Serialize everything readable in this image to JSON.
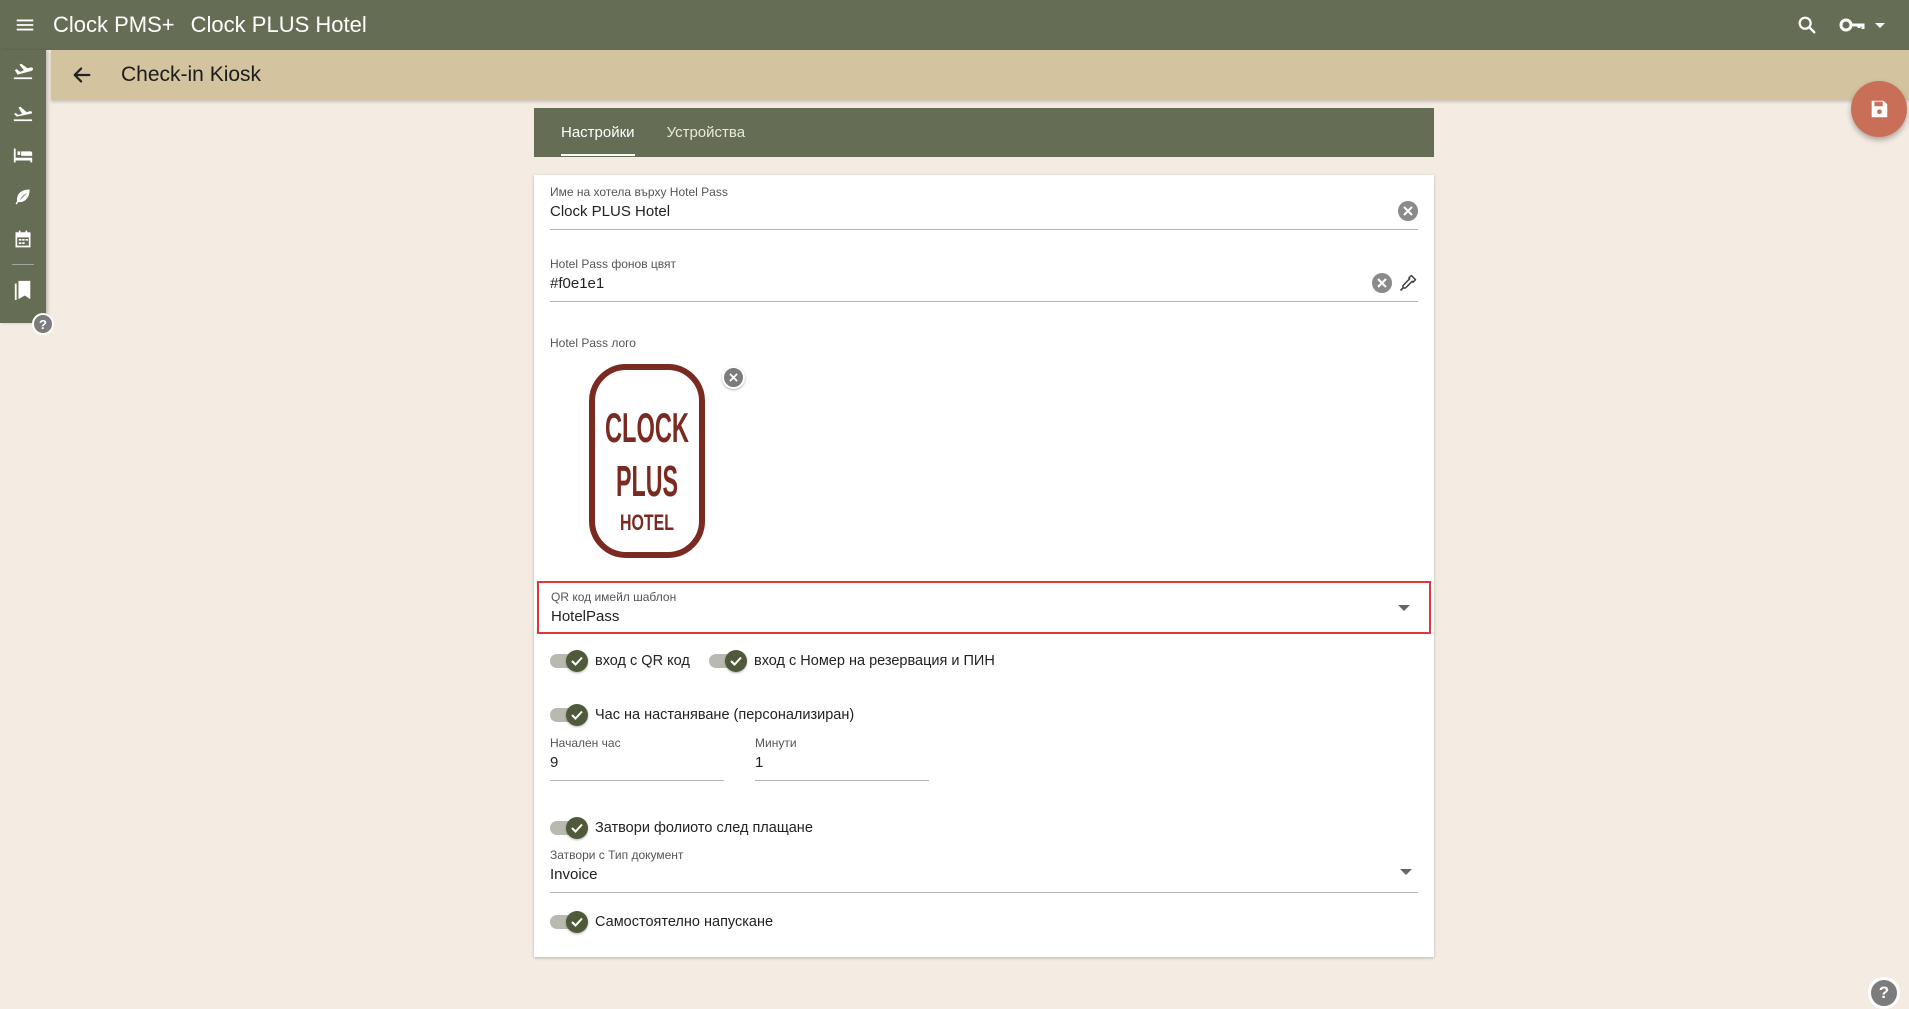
{
  "topbar": {
    "app_name": "Clock PMS+",
    "hotel_name": "Clock PLUS Hotel"
  },
  "subbar": {
    "title": "Check-in Kiosk"
  },
  "tabs": [
    {
      "label": "Настройки",
      "active": true
    },
    {
      "label": "Устройства",
      "active": false
    }
  ],
  "form": {
    "hotel_name": {
      "label": "Име на хотела върху Hotel Pass",
      "value": "Clock PLUS Hotel"
    },
    "bg_color": {
      "label": "Hotel Pass фонов цвят",
      "value": "#f0e1e1"
    },
    "logo": {
      "label": "Hotel Pass лого",
      "line1": "CLOCK",
      "line2": "PLUS",
      "line3": "HOTEL"
    },
    "qr_template": {
      "label": "QR код имейл шаблон",
      "value": "HotelPass"
    },
    "toggle_qr": {
      "label": "вход с QR код",
      "on": true
    },
    "toggle_pin": {
      "label": "вход с Номер на резервация и ПИН",
      "on": true
    },
    "toggle_checkin_time": {
      "label": "Час на настаняване (персонализиран)",
      "on": true
    },
    "start_hour": {
      "label": "Начален час",
      "value": "9"
    },
    "minutes": {
      "label": "Минути",
      "value": "1"
    },
    "toggle_close_folio": {
      "label": "Затвори фолиото след плащане",
      "on": true
    },
    "doc_type": {
      "label": "Затвори с Тип документ",
      "value": "Invoice"
    },
    "toggle_self_checkout": {
      "label": "Самостоятелно напускане",
      "on": true
    }
  },
  "help": {
    "symbol": "?"
  },
  "colors": {
    "primary": "#656e55",
    "subbar": "#d3c39f",
    "background": "#f4ece2",
    "fab": "#c96f57",
    "logo_brown": "#7b2a22",
    "highlight": "#e0363c"
  }
}
